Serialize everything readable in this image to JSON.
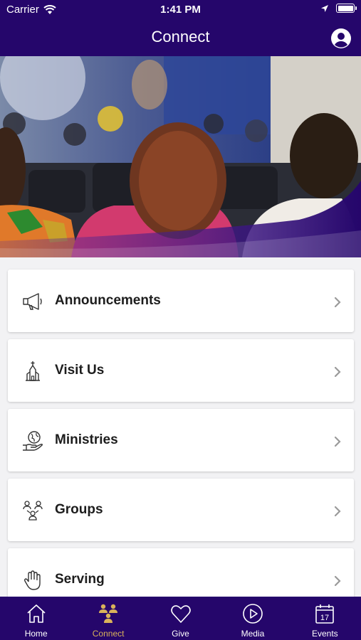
{
  "status_bar": {
    "carrier": "Carrier",
    "time": "1:41 PM"
  },
  "nav": {
    "title": "Connect",
    "profile_icon": "profile-icon"
  },
  "menu": [
    {
      "label": "Announcements",
      "icon": "megaphone-icon"
    },
    {
      "label": "Visit Us",
      "icon": "church-icon"
    },
    {
      "label": "Ministries",
      "icon": "globe-hand-icon"
    },
    {
      "label": "Groups",
      "icon": "groups-icon"
    },
    {
      "label": "Serving",
      "icon": "hand-icon"
    }
  ],
  "tabs": [
    {
      "label": "Home",
      "icon": "home-icon",
      "active": false
    },
    {
      "label": "Connect",
      "icon": "connect-icon",
      "active": true
    },
    {
      "label": "Give",
      "icon": "heart-icon",
      "active": false
    },
    {
      "label": "Media",
      "icon": "play-icon",
      "active": false
    },
    {
      "label": "Events",
      "icon": "calendar-icon",
      "active": false,
      "date_number": "17"
    }
  ],
  "colors": {
    "primary": "#25066b",
    "active_tab": "#d9b25a",
    "background": "#f2f2f4"
  }
}
